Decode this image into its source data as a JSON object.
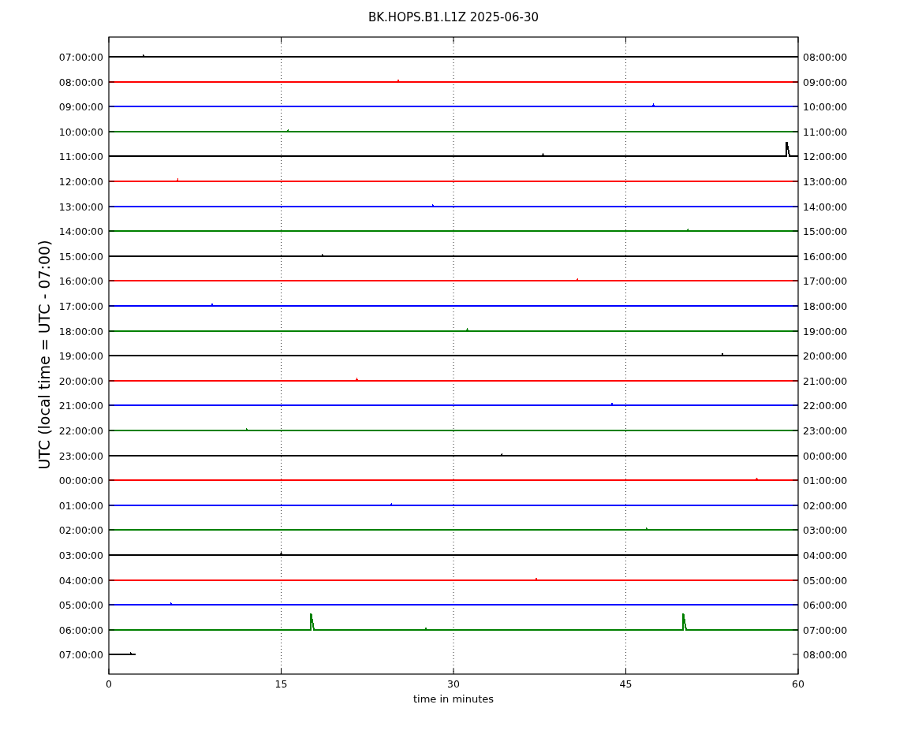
{
  "title": "BK.HOPS.B1.L1Z 2025-06-30",
  "ylabel": "UTC (local time = UTC - 07:00)",
  "xlabel": "time in minutes",
  "xticks": [
    "0",
    "15",
    "30",
    "45",
    "60"
  ],
  "rows": [
    {
      "left": "07:00:00",
      "right": "08:00:00",
      "color": "#000000"
    },
    {
      "left": "08:00:00",
      "right": "09:00:00",
      "color": "#ff0000"
    },
    {
      "left": "09:00:00",
      "right": "10:00:00",
      "color": "#0000ff"
    },
    {
      "left": "10:00:00",
      "right": "11:00:00",
      "color": "#008000"
    },
    {
      "left": "11:00:00",
      "right": "12:00:00",
      "color": "#000000"
    },
    {
      "left": "12:00:00",
      "right": "13:00:00",
      "color": "#ff0000"
    },
    {
      "left": "13:00:00",
      "right": "14:00:00",
      "color": "#0000ff"
    },
    {
      "left": "14:00:00",
      "right": "15:00:00",
      "color": "#008000"
    },
    {
      "left": "15:00:00",
      "right": "16:00:00",
      "color": "#000000"
    },
    {
      "left": "16:00:00",
      "right": "17:00:00",
      "color": "#ff0000"
    },
    {
      "left": "17:00:00",
      "right": "18:00:00",
      "color": "#0000ff"
    },
    {
      "left": "18:00:00",
      "right": "19:00:00",
      "color": "#008000"
    },
    {
      "left": "19:00:00",
      "right": "20:00:00",
      "color": "#000000"
    },
    {
      "left": "20:00:00",
      "right": "21:00:00",
      "color": "#ff0000"
    },
    {
      "left": "21:00:00",
      "right": "22:00:00",
      "color": "#0000ff"
    },
    {
      "left": "22:00:00",
      "right": "23:00:00",
      "color": "#008000"
    },
    {
      "left": "23:00:00",
      "right": "00:00:00",
      "color": "#000000"
    },
    {
      "left": "00:00:00",
      "right": "01:00:00",
      "color": "#ff0000"
    },
    {
      "left": "01:00:00",
      "right": "02:00:00",
      "color": "#0000ff"
    },
    {
      "left": "02:00:00",
      "right": "03:00:00",
      "color": "#008000"
    },
    {
      "left": "03:00:00",
      "right": "04:00:00",
      "color": "#000000"
    },
    {
      "left": "04:00:00",
      "right": "05:00:00",
      "color": "#ff0000"
    },
    {
      "left": "05:00:00",
      "right": "06:00:00",
      "color": "#0000ff"
    },
    {
      "left": "06:00:00",
      "right": "07:00:00",
      "color": "#008000"
    },
    {
      "left": "07:00:00",
      "right": "08:00:00",
      "color": "#000000"
    }
  ]
}
